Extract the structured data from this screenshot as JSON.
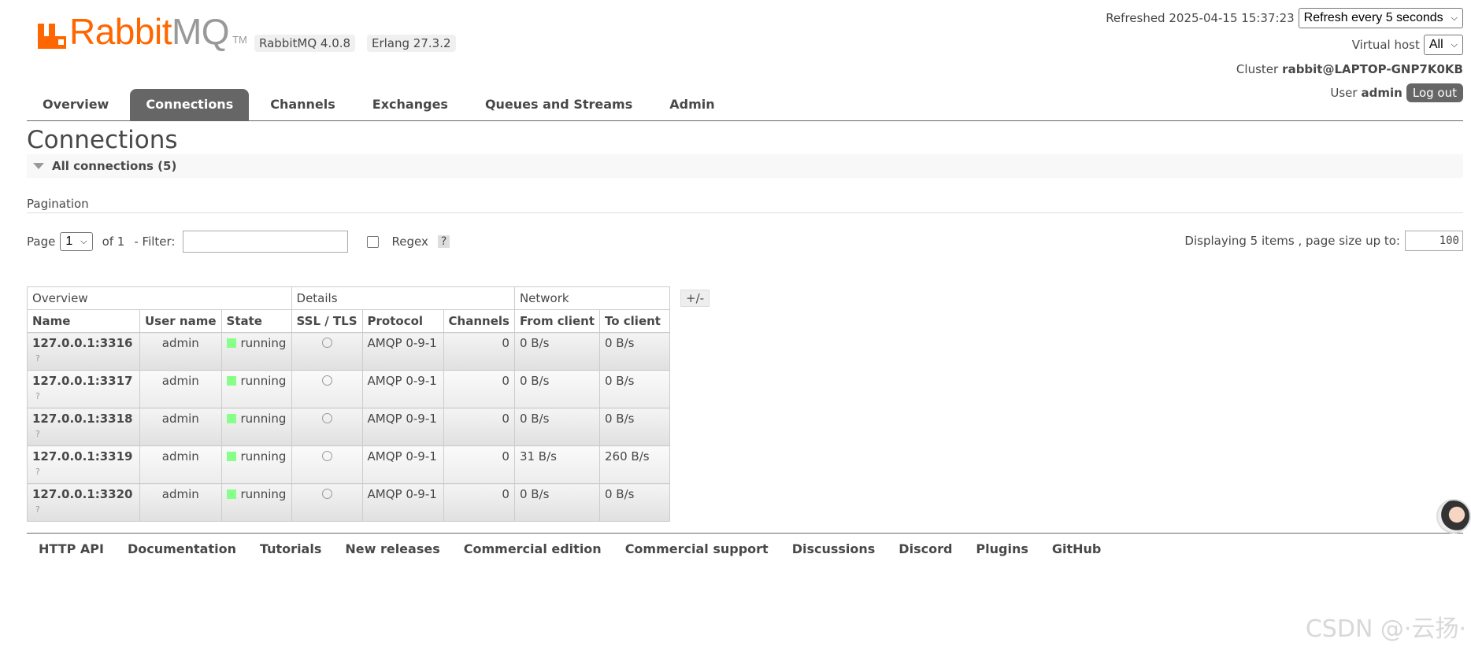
{
  "header": {
    "logo_rabbit": "Rabbit",
    "logo_mq": "MQ",
    "logo_tm": "TM",
    "rabbitmq_version": "RabbitMQ 4.0.8",
    "erlang_version": "Erlang 27.3.2",
    "refreshed_label": "Refreshed 2025-04-15 15:37:23",
    "refresh_select": "Refresh every 5 seconds",
    "vhost_label": "Virtual host",
    "vhost_select": "All",
    "cluster_label": "Cluster",
    "cluster_name": "rabbit@LAPTOP-GNP7K0KB",
    "user_label": "User",
    "user_name": "admin",
    "logout_label": "Log out"
  },
  "tabs": [
    {
      "label": "Overview"
    },
    {
      "label": "Connections"
    },
    {
      "label": "Channels"
    },
    {
      "label": "Exchanges"
    },
    {
      "label": "Queues and Streams"
    },
    {
      "label": "Admin"
    }
  ],
  "active_tab": "Connections",
  "page": {
    "title": "Connections",
    "section_label": "All connections (5)",
    "pagination_label": "Pagination",
    "page_label": "Page",
    "page_select": "1",
    "of_label": "of 1",
    "filter_label": "- Filter:",
    "filter_value": "",
    "regex_label": "Regex",
    "help_label": "?",
    "display_label": "Displaying 5 items , page size up to:",
    "page_size": "100",
    "plus_minus": "+/-"
  },
  "table": {
    "groups": [
      "Overview",
      "Details",
      "Network"
    ],
    "columns": [
      "Name",
      "User name",
      "State",
      "SSL / TLS",
      "Protocol",
      "Channels",
      "From client",
      "To client"
    ],
    "rows": [
      {
        "name": "127.0.0.1:3316",
        "q": "?",
        "user": "admin",
        "state": "running",
        "protocol": "AMQP 0-9-1",
        "channels": "0",
        "from": "0 B/s",
        "to": "0 B/s"
      },
      {
        "name": "127.0.0.1:3317",
        "q": "?",
        "user": "admin",
        "state": "running",
        "protocol": "AMQP 0-9-1",
        "channels": "0",
        "from": "0 B/s",
        "to": "0 B/s"
      },
      {
        "name": "127.0.0.1:3318",
        "q": "?",
        "user": "admin",
        "state": "running",
        "protocol": "AMQP 0-9-1",
        "channels": "0",
        "from": "0 B/s",
        "to": "0 B/s"
      },
      {
        "name": "127.0.0.1:3319",
        "q": "?",
        "user": "admin",
        "state": "running",
        "protocol": "AMQP 0-9-1",
        "channels": "0",
        "from": "31 B/s",
        "to": "260 B/s"
      },
      {
        "name": "127.0.0.1:3320",
        "q": "?",
        "user": "admin",
        "state": "running",
        "protocol": "AMQP 0-9-1",
        "channels": "0",
        "from": "0 B/s",
        "to": "0 B/s"
      }
    ]
  },
  "footer": {
    "links": [
      "HTTP API",
      "Documentation",
      "Tutorials",
      "New releases",
      "Commercial edition",
      "Commercial support",
      "Discussions",
      "Discord",
      "Plugins",
      "GitHub"
    ]
  },
  "watermark": "CSDN @·云扬·",
  "colors": {
    "brand": "#ff6600",
    "tab_active": "#666666",
    "running": "#88ff88"
  },
  "icons": {
    "collapse": "triangle-down-icon",
    "ssl": "circle-icon",
    "state": "green-square-icon",
    "dropdown": "chevron-down-icon"
  }
}
